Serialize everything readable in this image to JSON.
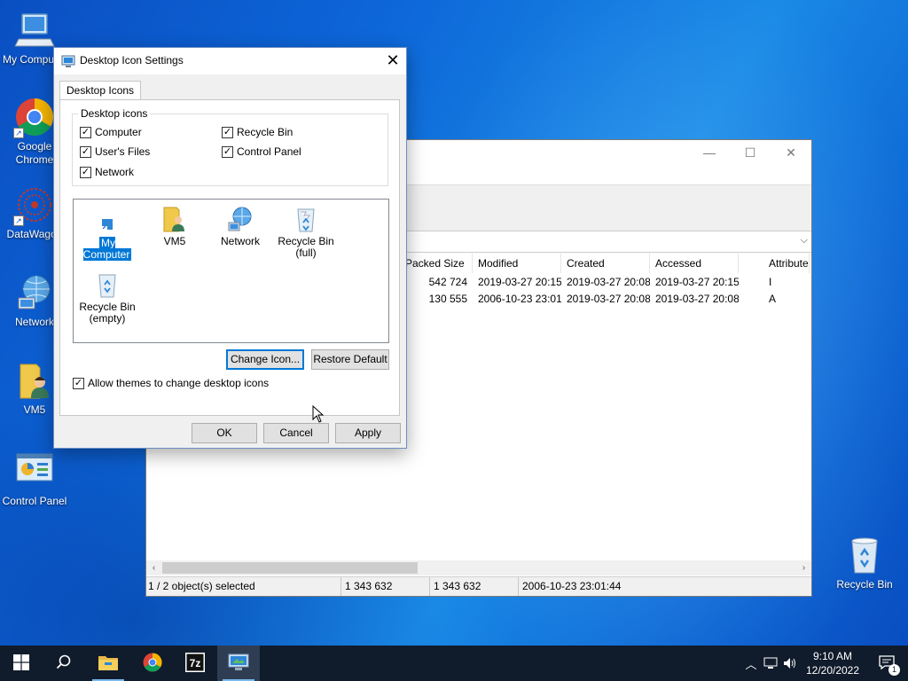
{
  "desktop": {
    "icons": [
      {
        "label": "My Computer"
      },
      {
        "label": "Google Chrome"
      },
      {
        "label": "DataWagon"
      },
      {
        "label": "Network"
      },
      {
        "label": "VM5"
      },
      {
        "label": "Control Panel"
      },
      {
        "label": "Recycle Bin"
      }
    ]
  },
  "file_manager": {
    "columns": [
      "Packed Size",
      "Modified",
      "Created",
      "Accessed",
      "Attributes"
    ],
    "rows": [
      {
        "packed": "542 724",
        "modified": "2019-03-27 20:15",
        "created": "2019-03-27 20:08",
        "accessed": "2019-03-27 20:15",
        "attr": "I"
      },
      {
        "packed": "130 555",
        "modified": "2006-10-23 23:01",
        "created": "2019-03-27 20:08",
        "accessed": "2019-03-27 20:08",
        "attr": "A"
      }
    ],
    "status": {
      "selected": "1 / 2 object(s) selected",
      "size": "1 343 632",
      "packed": "1 343 632",
      "date": "2006-10-23 23:01:44"
    }
  },
  "dialog": {
    "title": "Desktop Icon Settings",
    "tab": "Desktop Icons",
    "group_title": "Desktop icons",
    "checkboxes": {
      "computer": {
        "label": "Computer",
        "checked": true
      },
      "recycle_bin": {
        "label": "Recycle Bin",
        "checked": true
      },
      "users_files": {
        "label": "User's Files",
        "checked": true
      },
      "control_panel": {
        "label": "Control Panel",
        "checked": true
      },
      "network": {
        "label": "Network",
        "checked": true
      }
    },
    "icon_list": [
      {
        "label": "My Computer",
        "selected": true
      },
      {
        "label": "VM5"
      },
      {
        "label": "Network"
      },
      {
        "label": "Recycle Bin",
        "sub": "(full)"
      },
      {
        "label": "Recycle Bin",
        "sub": "(empty)"
      }
    ],
    "change_icon": "Change Icon...",
    "restore_default": "Restore Default",
    "allow_themes": {
      "label": "Allow themes to change desktop icons",
      "checked": true
    },
    "ok": "OK",
    "cancel": "Cancel",
    "apply": "Apply"
  },
  "taskbar": {
    "time": "9:10 AM",
    "date": "12/20/2022",
    "notification_count": "1",
    "apps": [
      "start-icon",
      "search-icon",
      "file-explorer-icon",
      "chrome-icon",
      "7zip-icon",
      "desktop-settings-icon"
    ]
  },
  "colors": {
    "accent": "#0078d7",
    "taskbar": "#101b2b",
    "desktop": "#0d66d8"
  }
}
